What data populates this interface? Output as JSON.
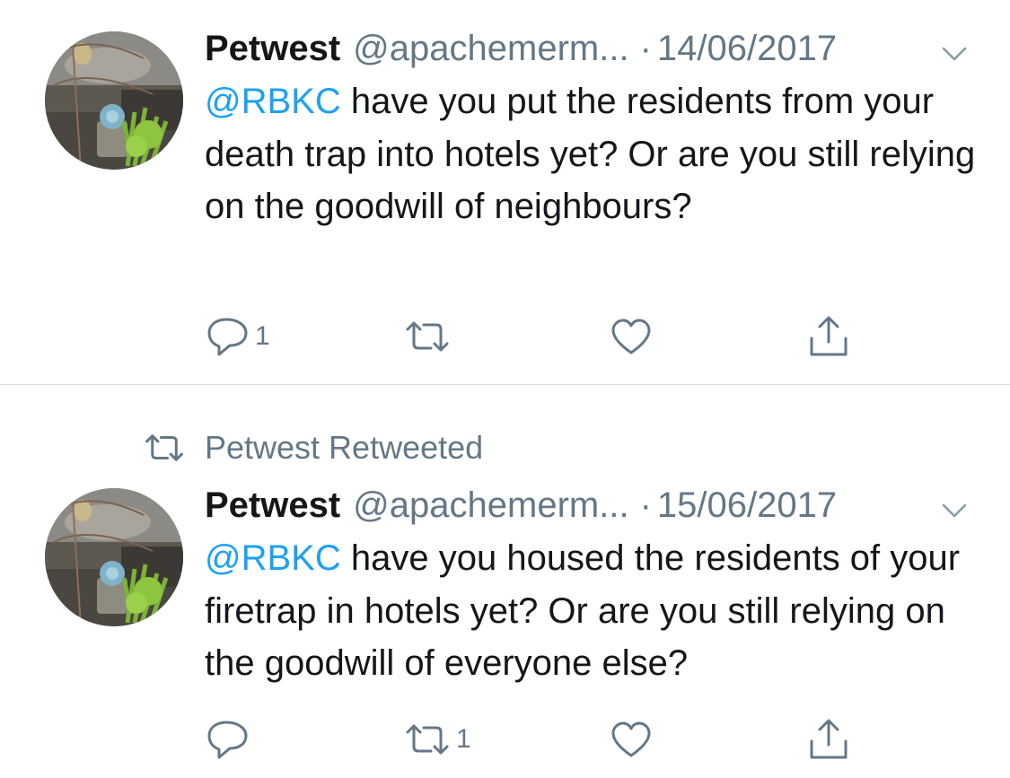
{
  "tweets": [
    {
      "name": "Petwest",
      "handle": "@apachemerm...",
      "separator": "·",
      "date": "14/06/2017",
      "mention": "@RBKC",
      "text": " have you put the residents from your death trap into hotels yet? Or are you still relying on the goodwill of neighbours?",
      "reply_count": "1",
      "retweet_count": "",
      "like_count": ""
    },
    {
      "social_context": "Petwest Retweeted",
      "name": "Petwest",
      "handle": "@apachemerm...",
      "separator": "·",
      "date": "15/06/2017",
      "mention": "@RBKC",
      "text": " have you housed the residents of your firetrap in hotels yet? Or are you still relying on the goodwill of everyone else?",
      "reply_count": "",
      "retweet_count": "1",
      "like_count": ""
    }
  ],
  "icons": {
    "reply": "reply-icon",
    "retweet": "retweet-icon",
    "like": "heart-icon",
    "share": "share-icon",
    "caret": "chevron-down-icon"
  },
  "colors": {
    "text": "#14171a",
    "secondary": "#657786",
    "mention": "#1da1f2",
    "divider": "#d8dfe4"
  }
}
